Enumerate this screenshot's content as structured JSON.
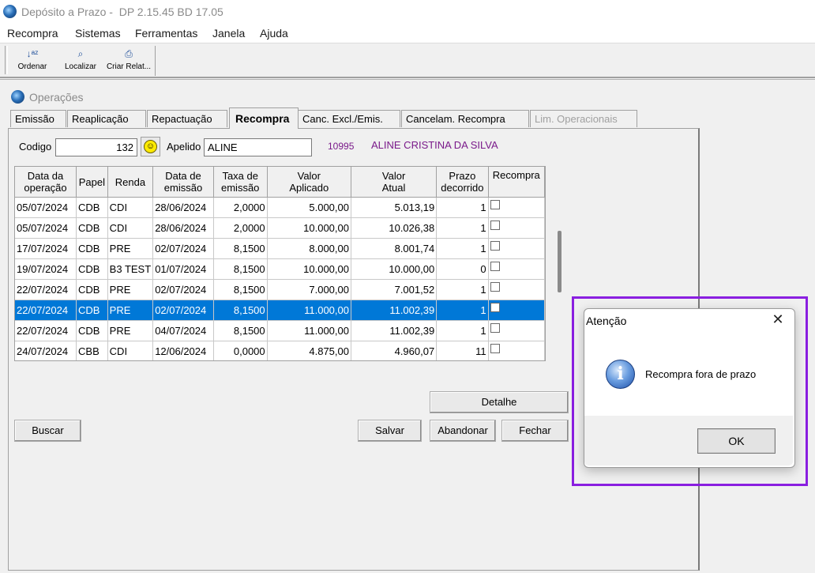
{
  "window": {
    "title": "Depósito a Prazo -  DP 2.15.45 BD 17.05"
  },
  "menu": [
    "Recompra",
    "Sistemas",
    "Ferramentas",
    "Janela",
    "Ajuda"
  ],
  "toolbar": [
    {
      "label": "Ordenar",
      "icon": "sort-az-icon"
    },
    {
      "label": "Localizar",
      "icon": "find-icon"
    },
    {
      "label": "Criar Relat...",
      "icon": "printer-icon"
    }
  ],
  "child_window": {
    "title": "Operações"
  },
  "tabs": [
    {
      "label": "Emissão",
      "state": "normal"
    },
    {
      "label": "Reaplicação",
      "state": "normal"
    },
    {
      "label": "Repactuação",
      "state": "normal"
    },
    {
      "label": "Recompra",
      "state": "active"
    },
    {
      "label": "Canc. Excl./Emis.",
      "state": "normal"
    },
    {
      "label": "Cancelam. Recompra",
      "state": "normal"
    },
    {
      "label": "Lim. Operacionais",
      "state": "disabled"
    }
  ],
  "form": {
    "codigo_label": "Codigo",
    "codigo_value": "132",
    "apelido_label": "Apelido",
    "apelido_value": "ALINE",
    "client_code": "10995",
    "client_name": "ALINE CRISTINA DA SILVA"
  },
  "grid": {
    "columns": [
      [
        "Data da",
        "operação"
      ],
      [
        "Papel",
        ""
      ],
      [
        "Renda",
        ""
      ],
      [
        "Data de",
        "emissão"
      ],
      [
        "Taxa de",
        "emissão"
      ],
      [
        "Valor",
        "Aplicado"
      ],
      [
        "Valor",
        "Atual"
      ],
      [
        "Prazo",
        "decorrido"
      ],
      [
        "Recompra",
        ""
      ]
    ],
    "rows": [
      [
        "05/07/2024",
        "CDB",
        "CDI",
        "28/06/2024",
        "2,0000",
        "5.000,00",
        "5.013,19",
        "1",
        false
      ],
      [
        "05/07/2024",
        "CDB",
        "CDI",
        "28/06/2024",
        "2,0000",
        "10.000,00",
        "10.026,38",
        "1",
        false
      ],
      [
        "17/07/2024",
        "CDB",
        "PRE",
        "02/07/2024",
        "8,1500",
        "8.000,00",
        "8.001,74",
        "1",
        false
      ],
      [
        "19/07/2024",
        "CDB",
        "B3 TEST",
        "01/07/2024",
        "8,1500",
        "10.000,00",
        "10.000,00",
        "0",
        false
      ],
      [
        "22/07/2024",
        "CDB",
        "PRE",
        "02/07/2024",
        "8,1500",
        "7.000,00",
        "7.001,52",
        "1",
        false
      ],
      [
        "22/07/2024",
        "CDB",
        "PRE",
        "02/07/2024",
        "8,1500",
        "11.000,00",
        "11.002,39",
        "1",
        false
      ],
      [
        "22/07/2024",
        "CDB",
        "PRE",
        "04/07/2024",
        "8,1500",
        "11.000,00",
        "11.002,39",
        "1",
        false
      ],
      [
        "24/07/2024",
        "CBB",
        "CDI",
        "12/06/2024",
        "0,0000",
        "4.875,00",
        "4.960,07",
        "11",
        false
      ]
    ],
    "selected_row": 5,
    "selection_color": "#0078d7"
  },
  "buttons": {
    "detalhe": "Detalhe",
    "buscar": "Buscar",
    "salvar": "Salvar",
    "abandonar": "Abandonar",
    "fechar": "Fechar"
  },
  "dialog": {
    "title": "Atenção",
    "close_glyph": "✕",
    "icon": "info-icon",
    "message": "Recompra fora de prazo",
    "ok_label": "OK",
    "highlight_color": "#8a1fe0"
  }
}
